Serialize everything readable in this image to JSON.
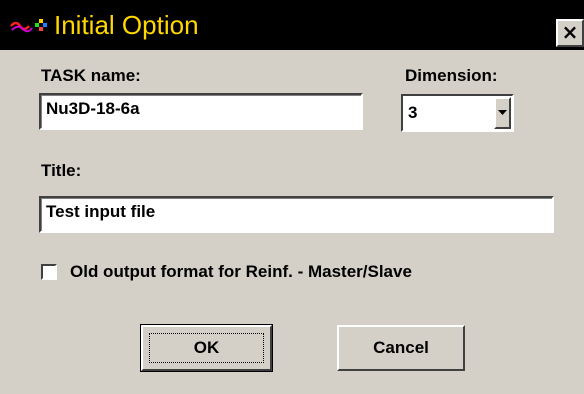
{
  "window": {
    "title": "Initial Option",
    "close_label": "×",
    "title_color": "#ffd700",
    "titlebar_color": "#000000",
    "app_icon": "app-icon"
  },
  "form": {
    "task_name_label": "TASK name:",
    "task_name_value": "Nu3D-18-6a",
    "dimension_label": "Dimension:",
    "dimension_value": "3",
    "title_label": "Title:",
    "title_value": "Test input file",
    "old_output_label": "Old output format for Reinf. - Master/Slave",
    "old_output_checked": false
  },
  "buttons": {
    "ok_label": "OK",
    "cancel_label": "Cancel"
  }
}
